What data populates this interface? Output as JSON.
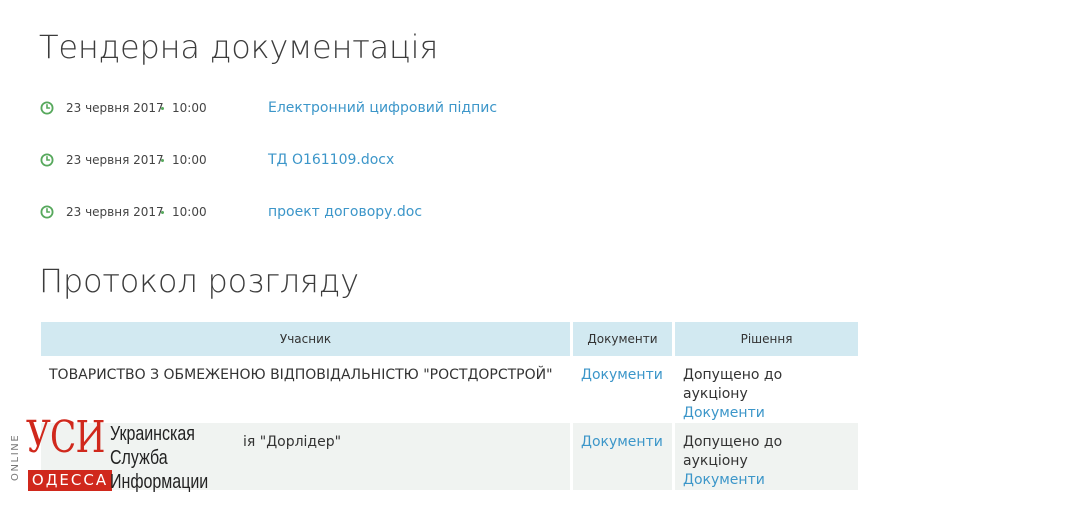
{
  "tender_docs": {
    "title": "Тендерна документація",
    "items": [
      {
        "date": "23 червня 2017",
        "time": "10:00",
        "name": "Електронний цифровий підпис"
      },
      {
        "date": "23 червня 2017",
        "time": "10:00",
        "name": "ТД О161109.docx"
      },
      {
        "date": "23 червня 2017",
        "time": "10:00",
        "name": "проект договору.doc"
      }
    ]
  },
  "protocol": {
    "title": "Протокол розгляду",
    "headers": {
      "participant": "Учасник",
      "documents": "Документи",
      "decision": "Рішення"
    },
    "rows": [
      {
        "participant": "ТОВАРИСТВО З ОБМЕЖЕНОЮ ВІДПОВІДАЛЬНІСТЮ \"РОСТДОРСТРОЙ\"",
        "documents": "Документи",
        "decision": "Допущено до аукціону",
        "decision_documents": "Документи"
      },
      {
        "participant": "ія \"Дорлідер\"",
        "documents": "Документи",
        "decision": "Допущено до аукціону",
        "decision_documents": "Документи"
      }
    ]
  },
  "watermark": {
    "online": "ONLINE",
    "brand": "УСИ",
    "city": "ОДЕССА",
    "agency_line1": "Украинская",
    "agency_line2": "Служба",
    "agency_line3": "Информации"
  },
  "colors": {
    "link": "#3c96c9",
    "clock_green": "#56a85c",
    "table_header_bg": "#d2e9f1",
    "row_alt_bg": "#f0f3f1",
    "logo_red": "#d0281c"
  },
  "icons": {
    "doc_time": "clock-icon"
  }
}
